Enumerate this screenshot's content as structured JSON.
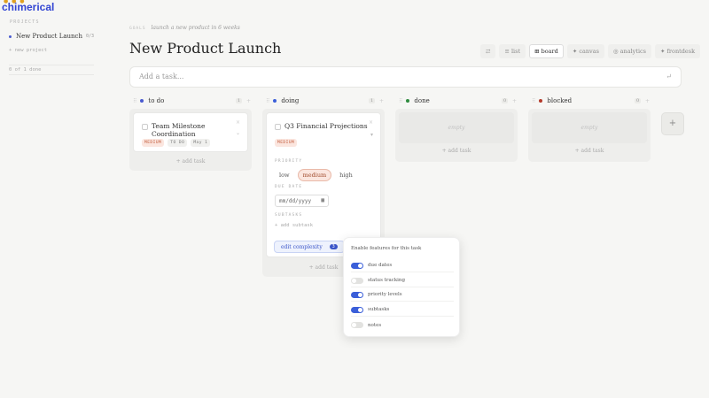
{
  "brand": {
    "name": "chimerical"
  },
  "sidebar": {
    "section_label": "PROJECTS",
    "project": {
      "name": "New Product Launch",
      "count": "0/3"
    },
    "new_project": "+ new project",
    "done_summary": "0 of 1 done"
  },
  "header": {
    "breadcrumb_label": "GOALS",
    "breadcrumb_goal": "launch a new product in 6 weeks",
    "title": "New Product Launch"
  },
  "views": [
    {
      "label": "⇄"
    },
    {
      "label": "≡ list"
    },
    {
      "label": "⊞ board"
    },
    {
      "label": "✦ canvas"
    },
    {
      "label": "◎ analytics"
    },
    {
      "label": "✦ frontdesk"
    }
  ],
  "add_task": {
    "placeholder": "Add a task...",
    "enter_glyph": "↵"
  },
  "columns": [
    {
      "name": "to do",
      "count": "1",
      "color": "#4a5bd0",
      "add_label": "+ add task"
    },
    {
      "name": "doing",
      "count": "1",
      "color": "#3b5fd9",
      "add_label": "+ add task"
    },
    {
      "name": "done",
      "count": "0",
      "color": "#2e8b3e",
      "add_label": "+ add task",
      "empty_label": "empty"
    },
    {
      "name": "blocked",
      "count": "0",
      "color": "#b33a2a",
      "add_label": "+ add task",
      "empty_label": "empty"
    }
  ],
  "cards": {
    "todo": {
      "title": "Team Milestone Coordination",
      "tags": [
        "MEDIUM",
        "TO DO",
        "May 1"
      ]
    },
    "doing": {
      "title": "Q3 Financial Projections",
      "tag": "MEDIUM",
      "priority_label": "PRIORITY",
      "priority_options": [
        "low",
        "medium",
        "high"
      ],
      "priority_selected": "medium",
      "due_label": "DUE DATE",
      "due_placeholder": "mm/dd/yyyy",
      "subtasks_label": "SUBTASKS",
      "add_subtask": "+ add subtask",
      "edit_label": "edit complexity",
      "edit_badge": "3"
    }
  },
  "add_column": "+",
  "popover": {
    "title": "Enable features for this task",
    "features": [
      {
        "label": "due dates",
        "on": true
      },
      {
        "label": "status tracking",
        "on": false
      },
      {
        "label": "priority levels",
        "on": true
      },
      {
        "label": "subtasks",
        "on": true
      },
      {
        "label": "notes",
        "on": false
      }
    ]
  },
  "colors": {
    "accent": "#3b5fd9",
    "brand": "#3346d3",
    "medium_tag": "#fbe6df"
  }
}
